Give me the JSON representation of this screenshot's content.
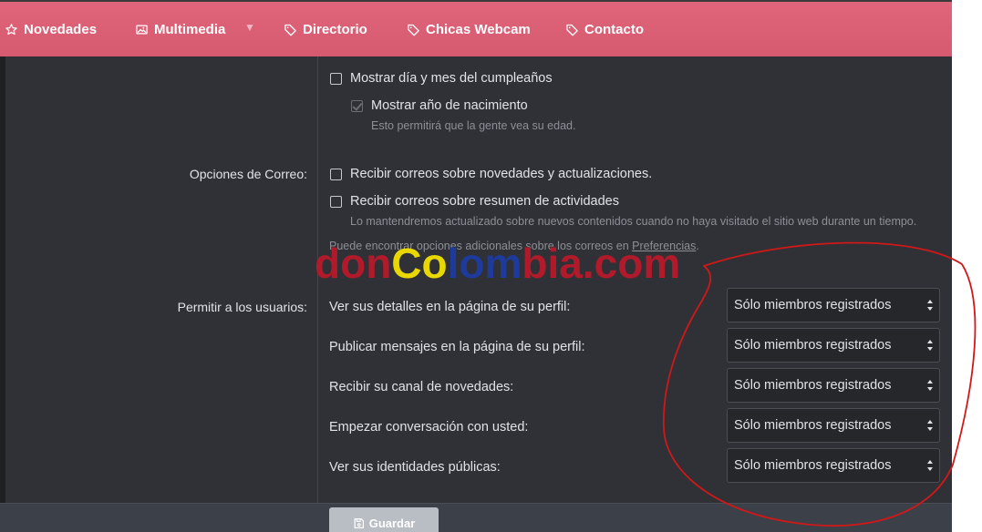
{
  "nav": {
    "items": [
      {
        "label": "Novedades",
        "icon": "star-icon"
      },
      {
        "label": "Multimedia",
        "icon": "image-icon"
      },
      {
        "label": "Directorio",
        "icon": "tag-icon"
      },
      {
        "label": "Chicas Webcam",
        "icon": "tag-icon"
      },
      {
        "label": "Contacto",
        "icon": "tag-icon"
      }
    ]
  },
  "birthday": {
    "show_day_month": "Mostrar día y mes del cumpleaños",
    "show_year": "Mostrar año de nacimiento",
    "show_year_hint": "Esto permitirá que la gente vea su edad."
  },
  "email": {
    "section_label": "Opciones de Correo:",
    "news_updates": "Recibir correos sobre novedades y actualizaciones.",
    "activity_summary": "Recibir correos sobre resumen de actividades",
    "activity_hint": "Lo mantendremos actualizado sobre nuevos contenidos cuando no haya visitado el sitio web durante un tiempo.",
    "more_prefix": "Puede encontrar opciones adicionales sobre los correos en ",
    "more_link": "Preferencias",
    "more_suffix": "."
  },
  "permissions": {
    "section_label": "Permitir a los usuarios:",
    "rows": [
      {
        "label": "Ver sus detalles en la página de su perfil:",
        "value": "Sólo miembros registrados"
      },
      {
        "label": "Publicar mensajes en la página de su perfil:",
        "value": "Sólo miembros registrados"
      },
      {
        "label": "Recibir su canal de novedades:",
        "value": "Sólo miembros registrados"
      },
      {
        "label": "Empezar conversación con usted:",
        "value": "Sólo miembros registrados"
      },
      {
        "label": "Ver sus identidades públicas:",
        "value": "Sólo miembros registrados"
      }
    ]
  },
  "save_label": "Guardar",
  "watermark": {
    "part1": "don",
    "part2": "Co",
    "part3": "lom",
    "part4": "bia.com"
  },
  "colors": {
    "nav_bg": "#d55a70",
    "panel_bg": "#2f3136",
    "annotation": "#d01818"
  }
}
